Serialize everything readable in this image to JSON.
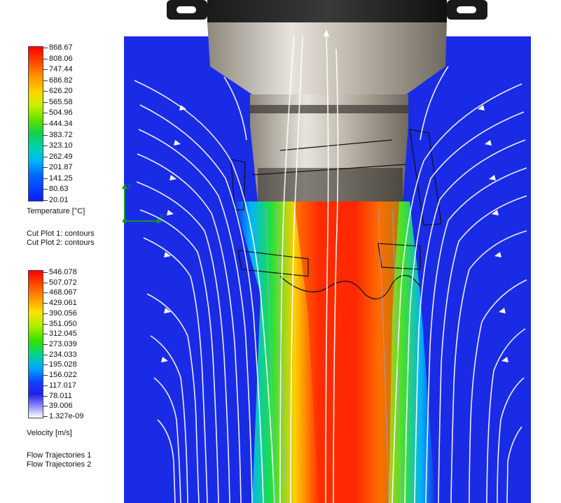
{
  "temperature_legend": {
    "ticks": [
      "868.67",
      "808.06",
      "747.44",
      "686.82",
      "626.20",
      "565.58",
      "504.96",
      "444.34",
      "383.72",
      "323.10",
      "262.49",
      "201.87",
      "141.25",
      "80.63",
      "20.01"
    ],
    "title": "Temperature [°C]"
  },
  "cut_plots": [
    "Cut Plot 1: contours",
    "Cut Plot 2: contours"
  ],
  "velocity_legend": {
    "ticks": [
      "546.078",
      "507.072",
      "468.067",
      "429.061",
      "390.056",
      "351.050",
      "312.045",
      "273.039",
      "234.033",
      "195.028",
      "156.022",
      "117.017",
      "78.011",
      "39.006",
      "1.327e-09"
    ],
    "title": "Velocity [m/s]"
  },
  "flow_trajectories": [
    "Flow Trajectories 1",
    "Flow Trajectories 2"
  ],
  "axis_triad": {
    "y": "Y",
    "x": "X"
  },
  "colors": {
    "background_flow": "#1a2be6",
    "hot_core": "#e8230f",
    "streamline": "#ffffff",
    "nozzle_metal": "#b8b2a6"
  }
}
